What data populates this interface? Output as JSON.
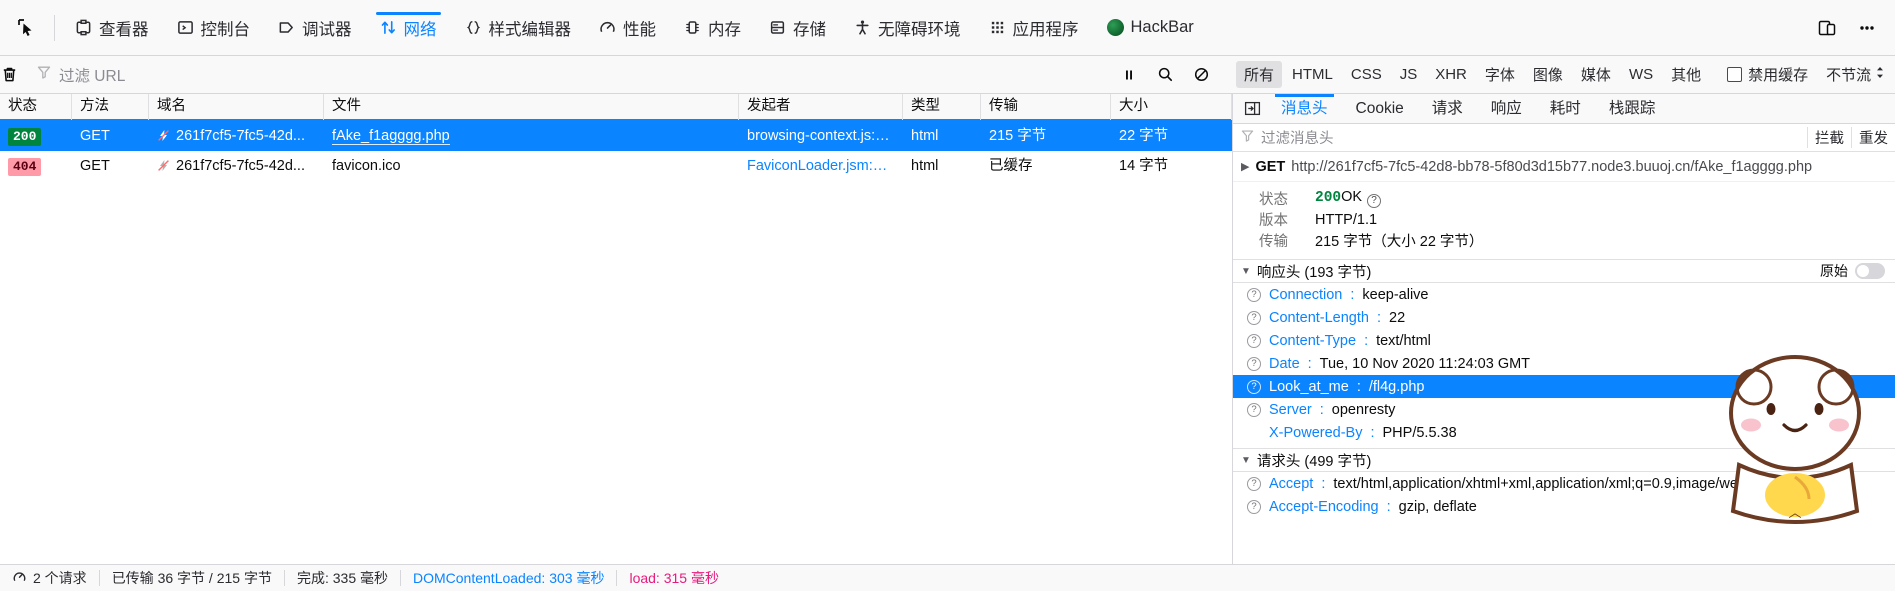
{
  "toolbox": {
    "picker_icon": "element-picker-icon",
    "tabs": [
      {
        "label": "查看器",
        "icon": "inspector-icon",
        "active": false
      },
      {
        "label": "控制台",
        "icon": "console-icon",
        "active": false
      },
      {
        "label": "调试器",
        "icon": "debugger-icon",
        "active": false
      },
      {
        "label": "网络",
        "icon": "network-icon",
        "active": true
      },
      {
        "label": "样式编辑器",
        "icon": "style-editor-icon",
        "active": false
      },
      {
        "label": "性能",
        "icon": "performance-icon",
        "active": false
      },
      {
        "label": "内存",
        "icon": "memory-icon",
        "active": false
      },
      {
        "label": "存储",
        "icon": "storage-icon",
        "active": false
      },
      {
        "label": "无障碍环境",
        "icon": "accessibility-icon",
        "active": false
      },
      {
        "label": "应用程序",
        "icon": "application-icon",
        "active": false
      },
      {
        "label": "HackBar",
        "icon": "hackbar-icon",
        "active": false
      }
    ],
    "right_buttons": [
      {
        "name": "responsive-design-mode-icon"
      },
      {
        "name": "meatball-menu-icon"
      }
    ]
  },
  "netbar": {
    "clear_icon": "trash-icon",
    "filter_icon": "funnel-icon",
    "filter_placeholder": "过滤 URL",
    "filter_value": "",
    "pause_icon": "pause-icon",
    "search_icon": "search-icon",
    "block_icon": "block-icon",
    "pills": [
      {
        "label": "所有",
        "active": true
      },
      {
        "label": "HTML",
        "active": false
      },
      {
        "label": "CSS",
        "active": false
      },
      {
        "label": "JS",
        "active": false
      },
      {
        "label": "XHR",
        "active": false
      },
      {
        "label": "字体",
        "active": false
      },
      {
        "label": "图像",
        "active": false
      },
      {
        "label": "媒体",
        "active": false
      },
      {
        "label": "WS",
        "active": false
      },
      {
        "label": "其他",
        "active": false
      }
    ],
    "disable_cache_label": "禁用缓存",
    "disable_cache_checked": false,
    "throttle_label": "不节流"
  },
  "request_table": {
    "columns": [
      {
        "key": "status",
        "label": "状态"
      },
      {
        "key": "method",
        "label": "方法"
      },
      {
        "key": "domain",
        "label": "域名"
      },
      {
        "key": "file",
        "label": "文件"
      },
      {
        "key": "initiator",
        "label": "发起者"
      },
      {
        "key": "type",
        "label": "类型"
      },
      {
        "key": "transferred",
        "label": "传输"
      },
      {
        "key": "size",
        "label": "大小"
      }
    ],
    "rows": [
      {
        "status": "200",
        "status_kind": "ok",
        "method": "GET",
        "domain": "261f7cf5-7fc5-42d...",
        "file": "fAke_f1agggg.php",
        "initiator": "browsing-context.js:1...",
        "type": "html",
        "transferred": "215 字节",
        "size": "22 字节",
        "selected": true,
        "security_icon": "insecure-http-icon"
      },
      {
        "status": "404",
        "status_kind": "error",
        "method": "GET",
        "domain": "261f7cf5-7fc5-42d...",
        "file": "favicon.ico",
        "initiator": "FaviconLoader.jsm:17...",
        "type": "html",
        "transferred": "已缓存",
        "size": "14 字节",
        "selected": false,
        "security_icon": "insecure-http-icon"
      }
    ]
  },
  "details": {
    "expand_icon": "expand-panel-icon",
    "tabs": [
      {
        "label": "消息头",
        "active": true
      },
      {
        "label": "Cookie",
        "active": false
      },
      {
        "label": "请求",
        "active": false
      },
      {
        "label": "响应",
        "active": false
      },
      {
        "label": "耗时",
        "active": false
      },
      {
        "label": "栈跟踪",
        "active": false
      }
    ],
    "filter_icon": "funnel-icon",
    "filter_placeholder": "过滤消息头",
    "filter_value": "",
    "actions": [
      "拦截",
      "重发"
    ],
    "url_row": {
      "triangle": "▶",
      "method": "GET",
      "url": "http://261f7cf5-7fc5-42d8-bb78-5f80d3d15b77.node3.buuoj.cn/fAke_f1agggg.php"
    },
    "summary": [
      {
        "key": "状态",
        "value": "200",
        "suffix": "OK",
        "kind": "status"
      },
      {
        "key": "版本",
        "value": "HTTP/1.1",
        "kind": "text"
      },
      {
        "key": "传输",
        "value": "215 字节（大小 22 字节）",
        "kind": "text"
      }
    ],
    "response_section": {
      "triangle": "▼",
      "title": "响应头 (193 字节)",
      "raw_label": "原始",
      "raw_on": false,
      "headers": [
        {
          "name": "Connection",
          "value": "keep-alive",
          "highlight": false
        },
        {
          "name": "Content-Length",
          "value": "22",
          "highlight": false
        },
        {
          "name": "Content-Type",
          "value": "text/html",
          "highlight": false
        },
        {
          "name": "Date",
          "value": "Tue, 10 Nov 2020 11:24:03 GMT",
          "highlight": false
        },
        {
          "name": "Look_at_me",
          "value": "/fl4g.php",
          "highlight": true
        },
        {
          "name": "Server",
          "value": "openresty",
          "highlight": false
        },
        {
          "name": "X-Powered-By",
          "value": "PHP/5.5.38",
          "highlight": false
        }
      ]
    },
    "request_section": {
      "triangle": "▼",
      "title": "请求头 (499 字节)",
      "headers": [
        {
          "name": "Accept",
          "value": "text/html,application/xhtml+xml,application/xml;q=0.9,image/webp,*/*;q=0.8",
          "highlight": false
        },
        {
          "name": "Accept-Encoding",
          "value": "gzip, deflate",
          "highlight": false
        }
      ]
    }
  },
  "statusbar": {
    "network_icon": "network-summary-icon",
    "requests": "2 个请求",
    "transferred": "已传输 36 字节 / 215 字节",
    "finish": "完成: 335 毫秒",
    "domcontentloaded": "DOMContentLoaded: 303 毫秒",
    "load": "load: 315 毫秒"
  },
  "colors": {
    "accent": "#0a84ff",
    "status_ok": "#00853e",
    "status_error": "#ff9aa8",
    "load_pink": "#e8197d",
    "chrome_bg": "#f9f9fa",
    "border": "#d7d7db"
  }
}
